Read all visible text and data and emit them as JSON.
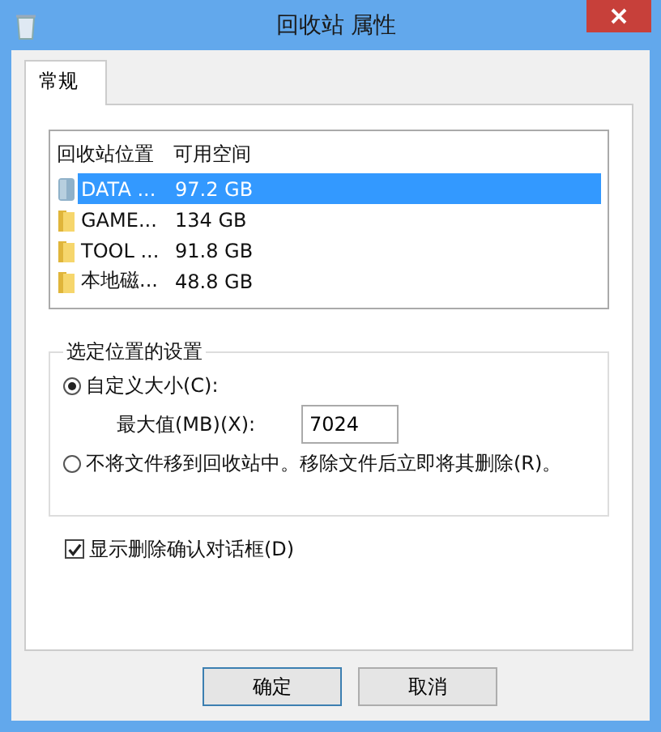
{
  "window": {
    "title": "回收站 属性"
  },
  "tabs": [
    {
      "label": "常规",
      "selected": true
    }
  ],
  "locations": {
    "columns": [
      "回收站位置",
      "可用空间"
    ],
    "rows": [
      {
        "name": "DATA ...",
        "space": "97.2 GB",
        "kind": "drive",
        "selected": true
      },
      {
        "name": "GAME...",
        "space": "134 GB",
        "kind": "folder",
        "selected": false
      },
      {
        "name": "TOOL ...",
        "space": "91.8 GB",
        "kind": "folder",
        "selected": false
      },
      {
        "name": "本地磁...",
        "space": "48.8 GB",
        "kind": "folder",
        "selected": false
      }
    ]
  },
  "settings": {
    "title": "选定位置的设置",
    "options": [
      {
        "label": "自定义大小(C):",
        "selected": true
      },
      {
        "label": "不将文件移到回收站中。移除文件后立即将其删除(R)。",
        "selected": false
      }
    ],
    "max_size": {
      "label": "最大值(MB)(X):",
      "value": "7024"
    }
  },
  "confirm": {
    "label": "显示删除确认对话框(D)",
    "checked": true
  },
  "buttons": [
    "确定",
    "取消"
  ]
}
